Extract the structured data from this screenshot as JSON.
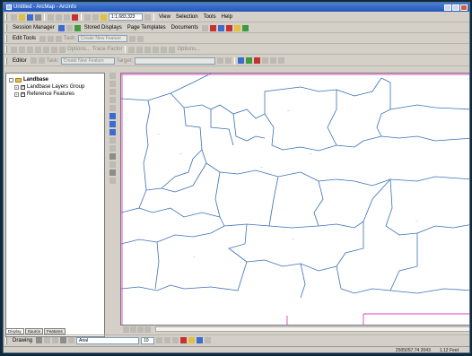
{
  "window": {
    "title": "Untitled - ArcMap - ArcInfo"
  },
  "toolbar1": {
    "scale": "1:1,683,323",
    "menus": [
      "View",
      "Selection",
      "Tools",
      "Help"
    ]
  },
  "toolbar2": {
    "session_manager": "Session Manager",
    "stored_displays": "Stored Displays",
    "page_templates": "Page Templates",
    "documents": "Documents"
  },
  "toolbar3": {
    "edit_tools": "Edit Tools",
    "task_label": "Task:",
    "task_value": "Create New Feature"
  },
  "toolbar4": {
    "options": "Options...",
    "trace_factor": "Trace Factor"
  },
  "toolbar5": {
    "editor": "Editor",
    "task_label": "Task:",
    "task_value": "Create New Feature",
    "target_label": "Target:"
  },
  "toc": {
    "root": "Landbase",
    "items": [
      "Landbase Layers Group",
      "Reference Features"
    ],
    "tabs": [
      "Display",
      "Source",
      "Features"
    ]
  },
  "drawing": {
    "label": "Drawing",
    "font": "Arial",
    "size": "10"
  },
  "status": {
    "coords": "2505057.74 2043",
    "scale_units": "1.12 Feet"
  },
  "colors": {
    "title_bar": "#2456b8",
    "boundary": "#3a6fb8",
    "extent": "#e040c0"
  }
}
